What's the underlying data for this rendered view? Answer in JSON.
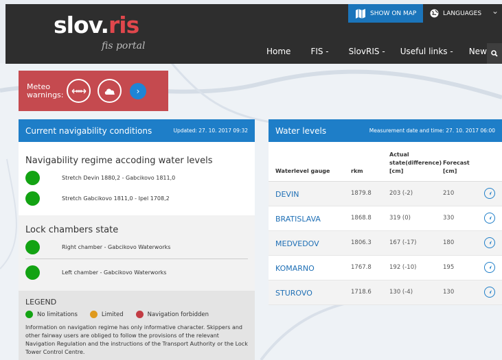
{
  "header": {
    "logo_main": "slov.",
    "logo_accent": "ris",
    "logo_sub": "fis portal",
    "show_on_map": "SHOW ON MAP",
    "languages": "LANGUAGES",
    "nav": [
      "Home",
      "FIS -",
      "SlovRIS -",
      "Useful links -",
      "News"
    ]
  },
  "meteo": {
    "label": "Meteo warnings:"
  },
  "navigability": {
    "title": "Current navigability conditions",
    "updated": "Updated: 27. 10. 2017 09:32",
    "regime_title": "Navigability regime accoding water levels",
    "stretches": [
      "Stretch Devin 1880,2 - Gabcikovo 1811,0",
      "Stretch Gabcikovo 1811,0 - Ipel 1708,2"
    ],
    "lock_title": "Lock chambers state",
    "chambers": [
      "Right chamber - Gabcikovo Waterworks",
      "Left chamber - Gabcikovo Waterworks"
    ],
    "legend_title": "LEGEND",
    "legend": [
      "No limitations",
      "Limited",
      "Navigation forbidden"
    ],
    "info": "Information on navigation regime has only informative character. Skippers and other fairway users are obliged to follow the provisions of the relevant Navigation Regulation and the instructions of the Transport Authority or the Lock Tower Control Centre."
  },
  "water_levels": {
    "title": "Water levels",
    "measured": "Measurement date and time: 27. 10. 2017 06:00",
    "columns": {
      "gauge": "Waterlevel gauge",
      "rkm": "rkm",
      "actual_l1": "Actual",
      "actual_l2": "state(difference)",
      "actual_l3": "[cm]",
      "forecast_l1": "Forecast",
      "forecast_l2": "[cm]"
    },
    "rows": [
      {
        "name": "DEVIN",
        "rkm": "1879.8",
        "actual": "203 (-2)",
        "forecast": "210"
      },
      {
        "name": "BRATISLAVA",
        "rkm": "1868.8",
        "actual": "319 (0)",
        "forecast": "330"
      },
      {
        "name": "MEDVEDOV",
        "rkm": "1806.3",
        "actual": "167 (-17)",
        "forecast": "180"
      },
      {
        "name": "KOMARNO",
        "rkm": "1767.8",
        "actual": "192 (-10)",
        "forecast": "195"
      },
      {
        "name": "STUROVO",
        "rkm": "1718.6",
        "actual": "130 (-4)",
        "forecast": "130"
      }
    ]
  }
}
